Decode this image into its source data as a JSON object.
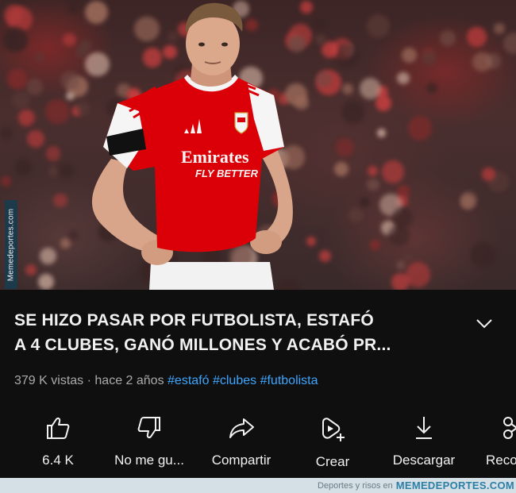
{
  "photo": {
    "jersey_sponsor_line1": "Emirates",
    "jersey_sponsor_line2": "FLY BETTER",
    "side_watermark": "Memedeportes.com"
  },
  "video": {
    "title_line1": "SE HIZO PASAR POR FUTBOLISTA, ESTAFÓ",
    "title_line2": "A 4 CLUBES, GANÓ MILLONES Y ACABÓ PR...",
    "views": "379 K vistas",
    "separator": "·",
    "age": "hace 2 años",
    "hashtags": [
      "#estafó",
      "#clubes",
      "#futbolista"
    ]
  },
  "actions": [
    {
      "label": "6.4 K",
      "icon": "thumbs-up-icon"
    },
    {
      "label": "No me gu...",
      "icon": "thumbs-down-icon"
    },
    {
      "label": "Compartir",
      "icon": "share-icon"
    },
    {
      "label": "Crear",
      "icon": "create-icon"
    },
    {
      "label": "Descargar",
      "icon": "download-icon"
    },
    {
      "label": "Reco",
      "icon": "scissors-icon"
    }
  ],
  "footer": {
    "credit_prefix": "Deportes y risos en",
    "credit_site": "MEMEDEPORTES.COM"
  },
  "colors": {
    "background": "#0f0f0f",
    "hashtag": "#3ea6ff",
    "jersey_red": "#db0007"
  }
}
